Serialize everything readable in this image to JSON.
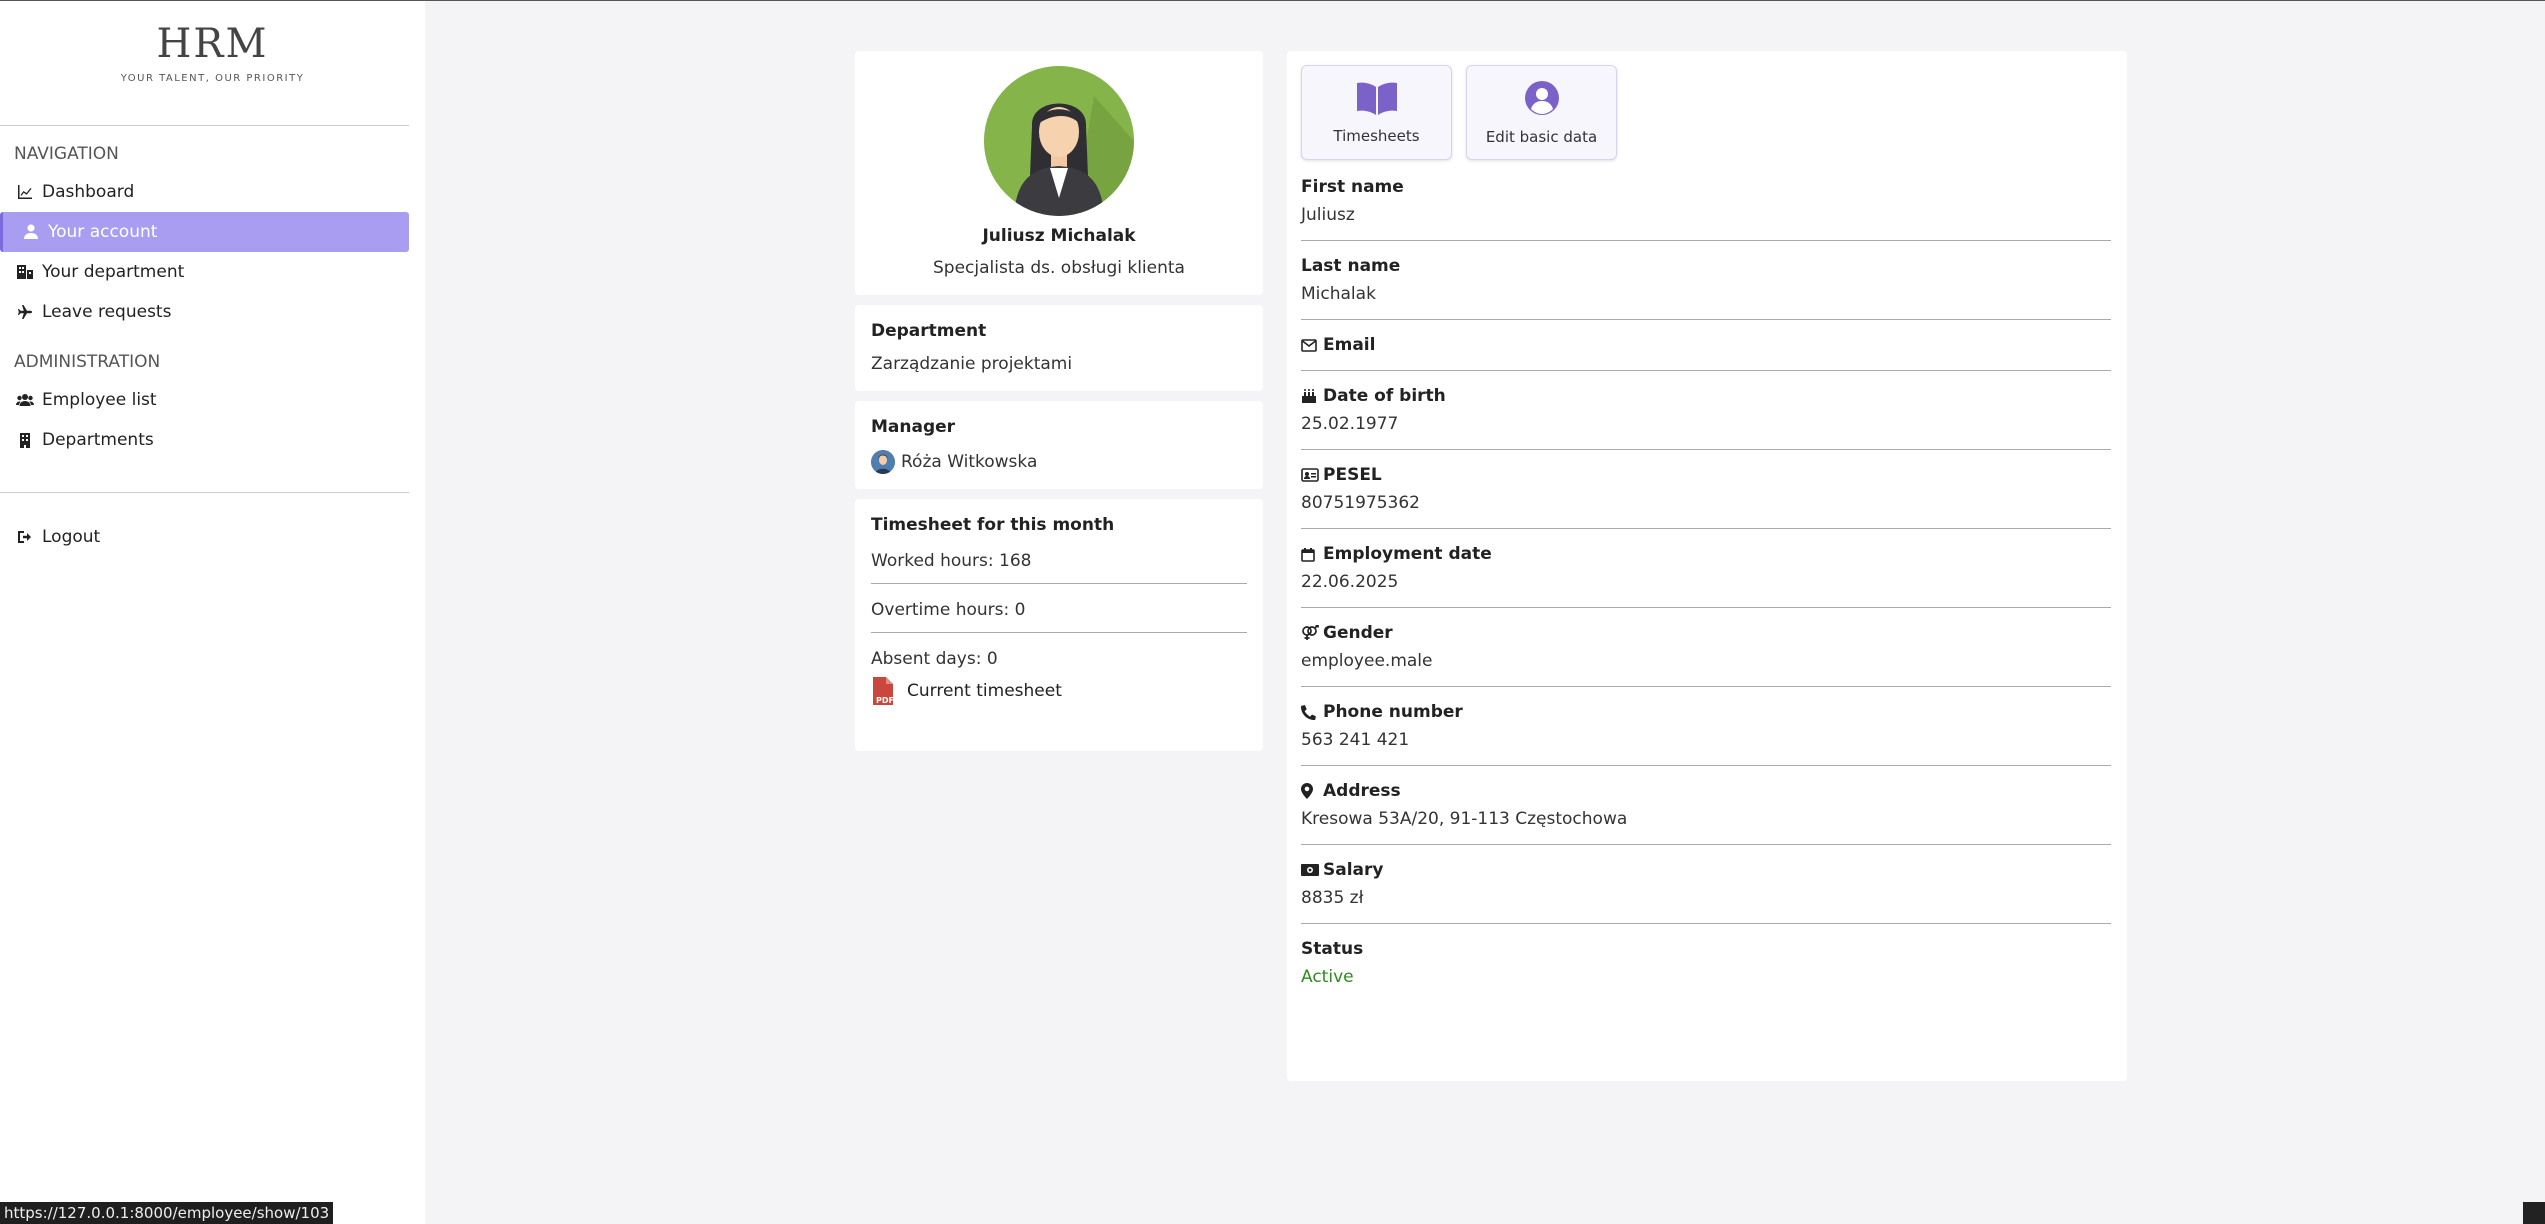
{
  "brand": {
    "logo": "HRM",
    "tagline": "YOUR TALENT, OUR PRIORITY"
  },
  "sidebar": {
    "navigation_label": "NAVIGATION",
    "nav_items": [
      {
        "label": "Dashboard",
        "icon": "chart-line-icon"
      },
      {
        "label": "Your account",
        "icon": "user-icon",
        "active": true
      },
      {
        "label": "Your department",
        "icon": "building-icon"
      },
      {
        "label": "Leave requests",
        "icon": "plane-icon"
      }
    ],
    "administration_label": "ADMINISTRATION",
    "admin_items": [
      {
        "label": "Employee list",
        "icon": "users-icon"
      },
      {
        "label": "Departments",
        "icon": "building-icon"
      }
    ],
    "logout_label": "Logout"
  },
  "profile": {
    "name": "Juliusz Michalak",
    "role": "Specjalista ds. obsługi klienta"
  },
  "department": {
    "title": "Department",
    "value": "Zarządzanie projektami"
  },
  "manager": {
    "title": "Manager",
    "value": "Róża Witkowska"
  },
  "timesheet": {
    "title": "Timesheet for this month",
    "worked": "Worked hours: 168",
    "overtime": "Overtime hours: 0",
    "absent": "Absent days: 0",
    "link_label": "Current timesheet"
  },
  "actions": {
    "timesheets": "Timesheets",
    "edit": "Edit basic data"
  },
  "details": {
    "first_name": {
      "label": "First name",
      "value": "Juliusz"
    },
    "last_name": {
      "label": "Last name",
      "value": "Michalak"
    },
    "email": {
      "label": "Email",
      "value": ""
    },
    "dob": {
      "label": "Date of birth",
      "value": "25.02.1977"
    },
    "pesel": {
      "label": "PESEL",
      "value": "80751975362"
    },
    "employment": {
      "label": "Employment date",
      "value": "22.06.2025"
    },
    "gender": {
      "label": "Gender",
      "value": "employee.male"
    },
    "phone": {
      "label": "Phone number",
      "value": "563 241 421"
    },
    "address": {
      "label": "Address",
      "value": "Kresowa 53A/20, 91-113 Częstochowa"
    },
    "salary": {
      "label": "Salary",
      "value": "8835 zł"
    },
    "status": {
      "label": "Status",
      "value": "Active"
    }
  },
  "colors": {
    "accent": "#a99df2",
    "accent_dark": "#7a6be0",
    "status_active": "#2e8b1f",
    "pdf_red": "#c9473b"
  },
  "status_url": "https://127.0.0.1:8000/employee/show/103"
}
